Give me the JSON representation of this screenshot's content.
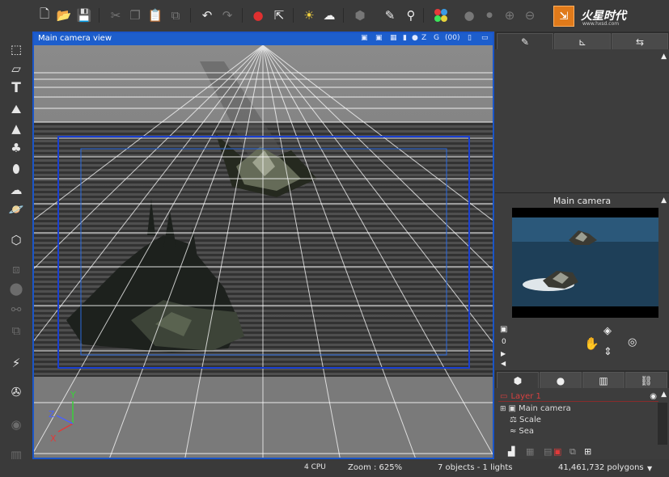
{
  "toolbar": {
    "icons": [
      "new-file-icon",
      "open-folder-icon",
      "save-icon",
      "cut-icon",
      "copy-icon",
      "paste-icon",
      "duplicate-icon",
      "undo-icon",
      "redo-icon",
      "render-icon",
      "render-area-icon",
      "weather-icon",
      "cloud-icon",
      "terrain-icon",
      "light-icon",
      "camera-icon",
      "color-wheel-icon",
      "dot-icon",
      "dot-icon",
      "plus-icon",
      "minus-icon"
    ]
  },
  "logo": {
    "text": "火星时代",
    "url": "www.hxsd.com"
  },
  "viewport": {
    "title": "Main camera view",
    "header_icons": [
      "camera-icon",
      "camera-icon",
      "grid-icon",
      "lock-icon",
      "Z",
      "G",
      "(00)",
      "options-icon",
      "maximize-icon"
    ]
  },
  "right_panel": {
    "tabs": [
      "editor-tab",
      "ruler-tab",
      "link-tab"
    ],
    "camera_panel_title": "Main camera",
    "camera_frame_value": "0",
    "object_tabs": [
      "objects-tab",
      "materials-tab",
      "layers-tab",
      "links-tab"
    ],
    "tree": {
      "layer": "Layer 1",
      "items": [
        "Main camera",
        "Scale",
        "Sea"
      ]
    }
  },
  "status": {
    "cpu": "4 CPU",
    "zoom": "Zoom : 625%",
    "objects": "7 objects - 1 lights",
    "polygons": "41,461,732 polygons"
  },
  "axes": {
    "x": "X",
    "y": "Y",
    "z": "Z"
  },
  "colors": {
    "accent": "#1d5ecc",
    "layer_red": "#d84040",
    "logo_orange": "#e07a1a"
  }
}
